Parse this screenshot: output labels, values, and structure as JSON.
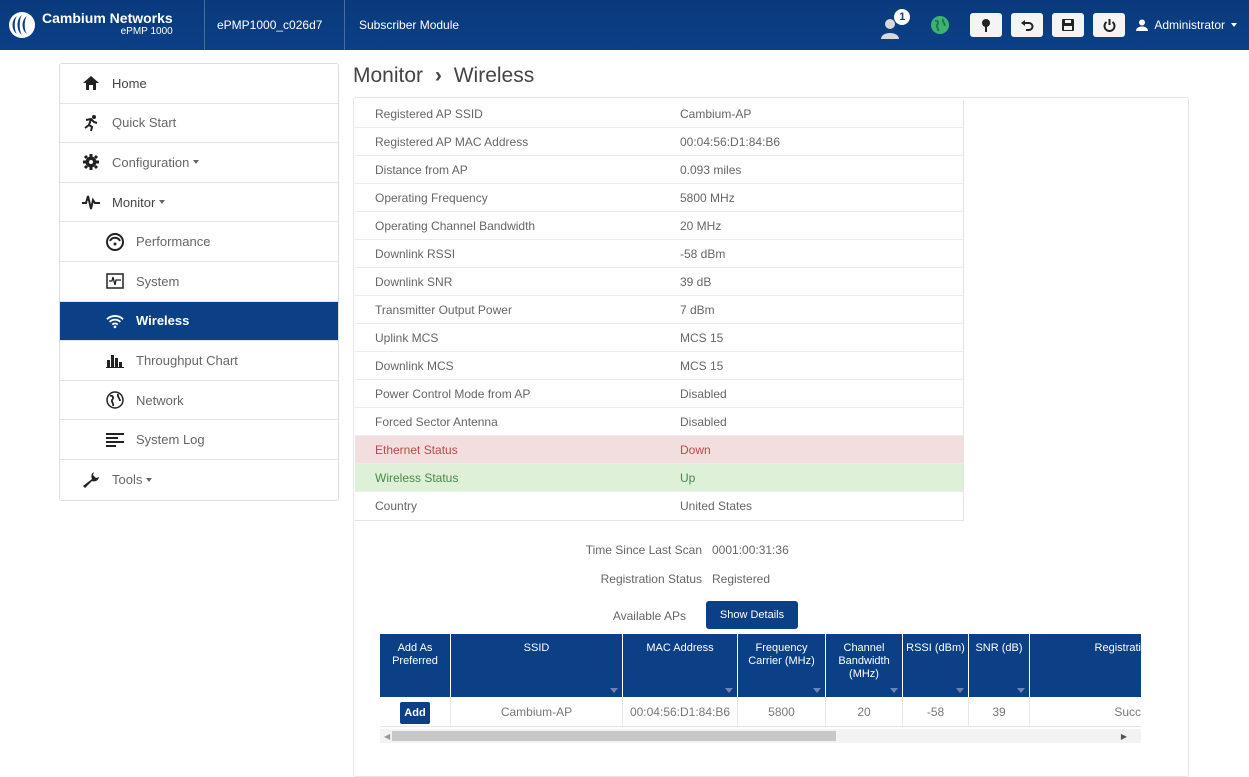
{
  "topbar": {
    "brand_name": "Cambium Networks",
    "brand_sub": "ePMP 1000",
    "device_name": "ePMP1000_c026d7",
    "device_mode": "Subscriber Module",
    "notification_count": "1",
    "user": "Administrator",
    "accent_color": "#0b3f86"
  },
  "sidebar": {
    "items": [
      {
        "label": "Home",
        "icon": "home-icon"
      },
      {
        "label": "Quick Start",
        "icon": "runner-icon"
      },
      {
        "label": "Configuration",
        "icon": "gear-icon"
      },
      {
        "label": "Monitor",
        "icon": "pulse-icon"
      },
      {
        "label": "Performance",
        "icon": "gauge-icon"
      },
      {
        "label": "System",
        "icon": "system-monitor-icon"
      },
      {
        "label": "Wireless",
        "icon": "wifi-icon"
      },
      {
        "label": "Throughput Chart",
        "icon": "bar-chart-icon"
      },
      {
        "label": "Network",
        "icon": "network-globe-icon"
      },
      {
        "label": "System Log",
        "icon": "log-lines-icon"
      },
      {
        "label": "Tools",
        "icon": "wrench-icon"
      }
    ]
  },
  "main": {
    "breadcrumb_section": "Monitor",
    "breadcrumb_sep": "›",
    "breadcrumb_page": "Wireless",
    "info_rows": [
      {
        "label": "Registered AP SSID",
        "value": "Cambium-AP"
      },
      {
        "label": "Registered AP MAC Address",
        "value": "00:04:56:D1:84:B6"
      },
      {
        "label": "Distance from AP",
        "value": "0.093 miles"
      },
      {
        "label": "Operating Frequency",
        "value": "5800 MHz"
      },
      {
        "label": "Operating Channel Bandwidth",
        "value": "20 MHz"
      },
      {
        "label": "Downlink RSSI",
        "value": "-58 dBm"
      },
      {
        "label": "Downlink SNR",
        "value": "39 dB"
      },
      {
        "label": "Transmitter Output Power",
        "value": "7 dBm"
      },
      {
        "label": "Uplink MCS",
        "value": "MCS 15"
      },
      {
        "label": "Downlink MCS",
        "value": "MCS 15"
      },
      {
        "label": "Power Control Mode from AP",
        "value": "Disabled"
      },
      {
        "label": "Forced Sector Antenna",
        "value": "Disabled"
      },
      {
        "label": "Ethernet Status",
        "value": "Down"
      },
      {
        "label": "Wireless Status",
        "value": "Up"
      },
      {
        "label": "Country",
        "value": "United States"
      }
    ],
    "scan": {
      "time_label": "Time Since Last Scan",
      "time_value": "0001:00:31:36",
      "reg_label": "Registration Status",
      "reg_value": "Registered",
      "aps_label": "Available APs",
      "show_details": "Show Details"
    },
    "grid": {
      "columns": [
        "Add As Preferred",
        "SSID",
        "MAC Address",
        "Frequency Carrier (MHz)",
        "Channel Bandwidth (MHz)",
        "RSSI (dBm)",
        "SNR (dB)",
        "Registrati"
      ],
      "row": {
        "add": "Add",
        "ssid": "Cambium-AP",
        "mac": "00:04:56:D1:84:B6",
        "freq": "5800",
        "bw": "20",
        "rssi": "-58",
        "snr": "39",
        "reg": "Succ"
      }
    }
  }
}
